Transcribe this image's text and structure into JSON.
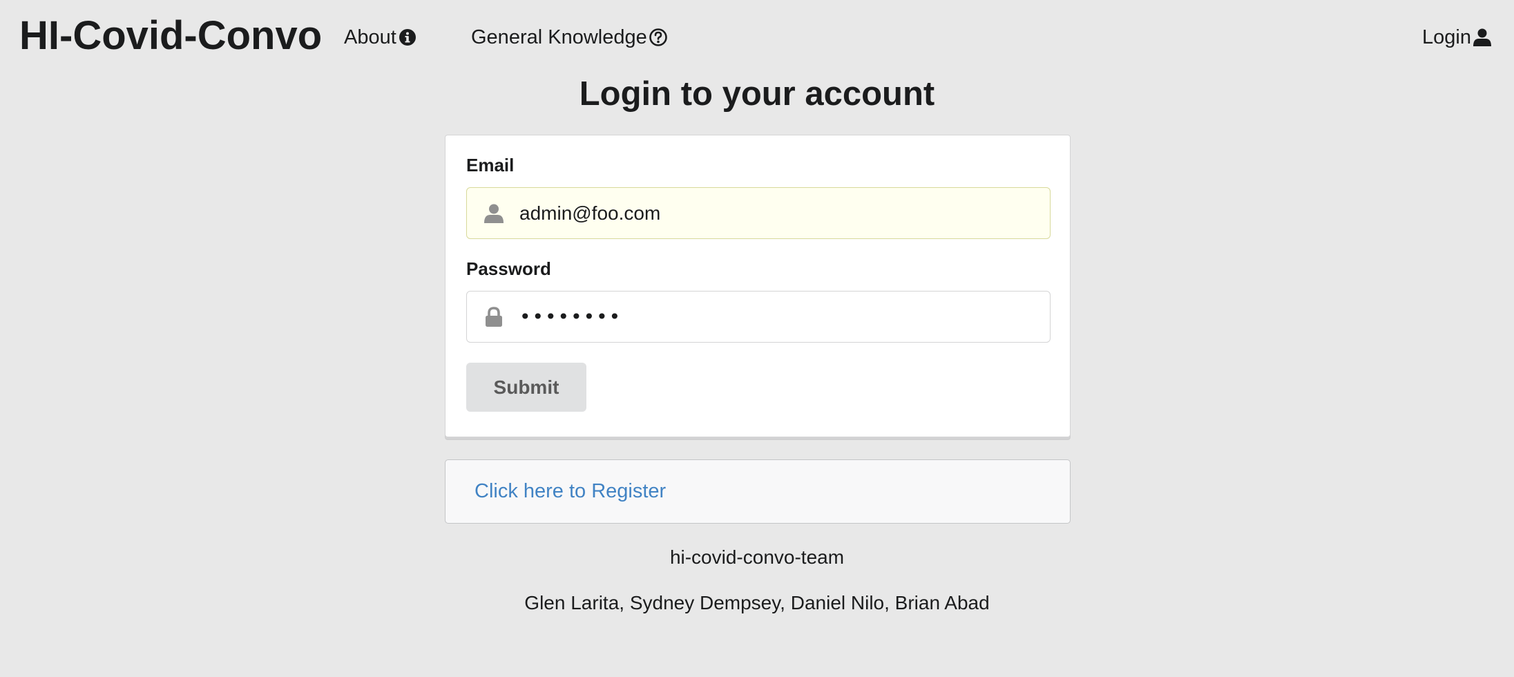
{
  "navbar": {
    "brand": "HI-Covid-Convo",
    "about_label": "About",
    "about_icon": "info-circle-icon",
    "general_knowledge_label": "General Knowledge",
    "general_knowledge_icon": "question-circle-icon",
    "login_label": "Login",
    "login_icon": "user-icon"
  },
  "main": {
    "title": "Login to your account",
    "form": {
      "email_label": "Email",
      "email_value": "admin@foo.com",
      "email_icon": "user-icon",
      "password_label": "Password",
      "password_value": "••••••••",
      "password_icon": "lock-icon",
      "submit_label": "Submit"
    },
    "register_link": "Click here to Register"
  },
  "footer": {
    "team": "hi-covid-convo-team",
    "members": "Glen Larita, Sydney Dempsey, Daniel Nilo, Brian Abad"
  },
  "colors": {
    "background": "#e8e8e8",
    "link": "#4183c4",
    "autofill_background": "#fffff0",
    "button_background": "#e0e1e2"
  }
}
